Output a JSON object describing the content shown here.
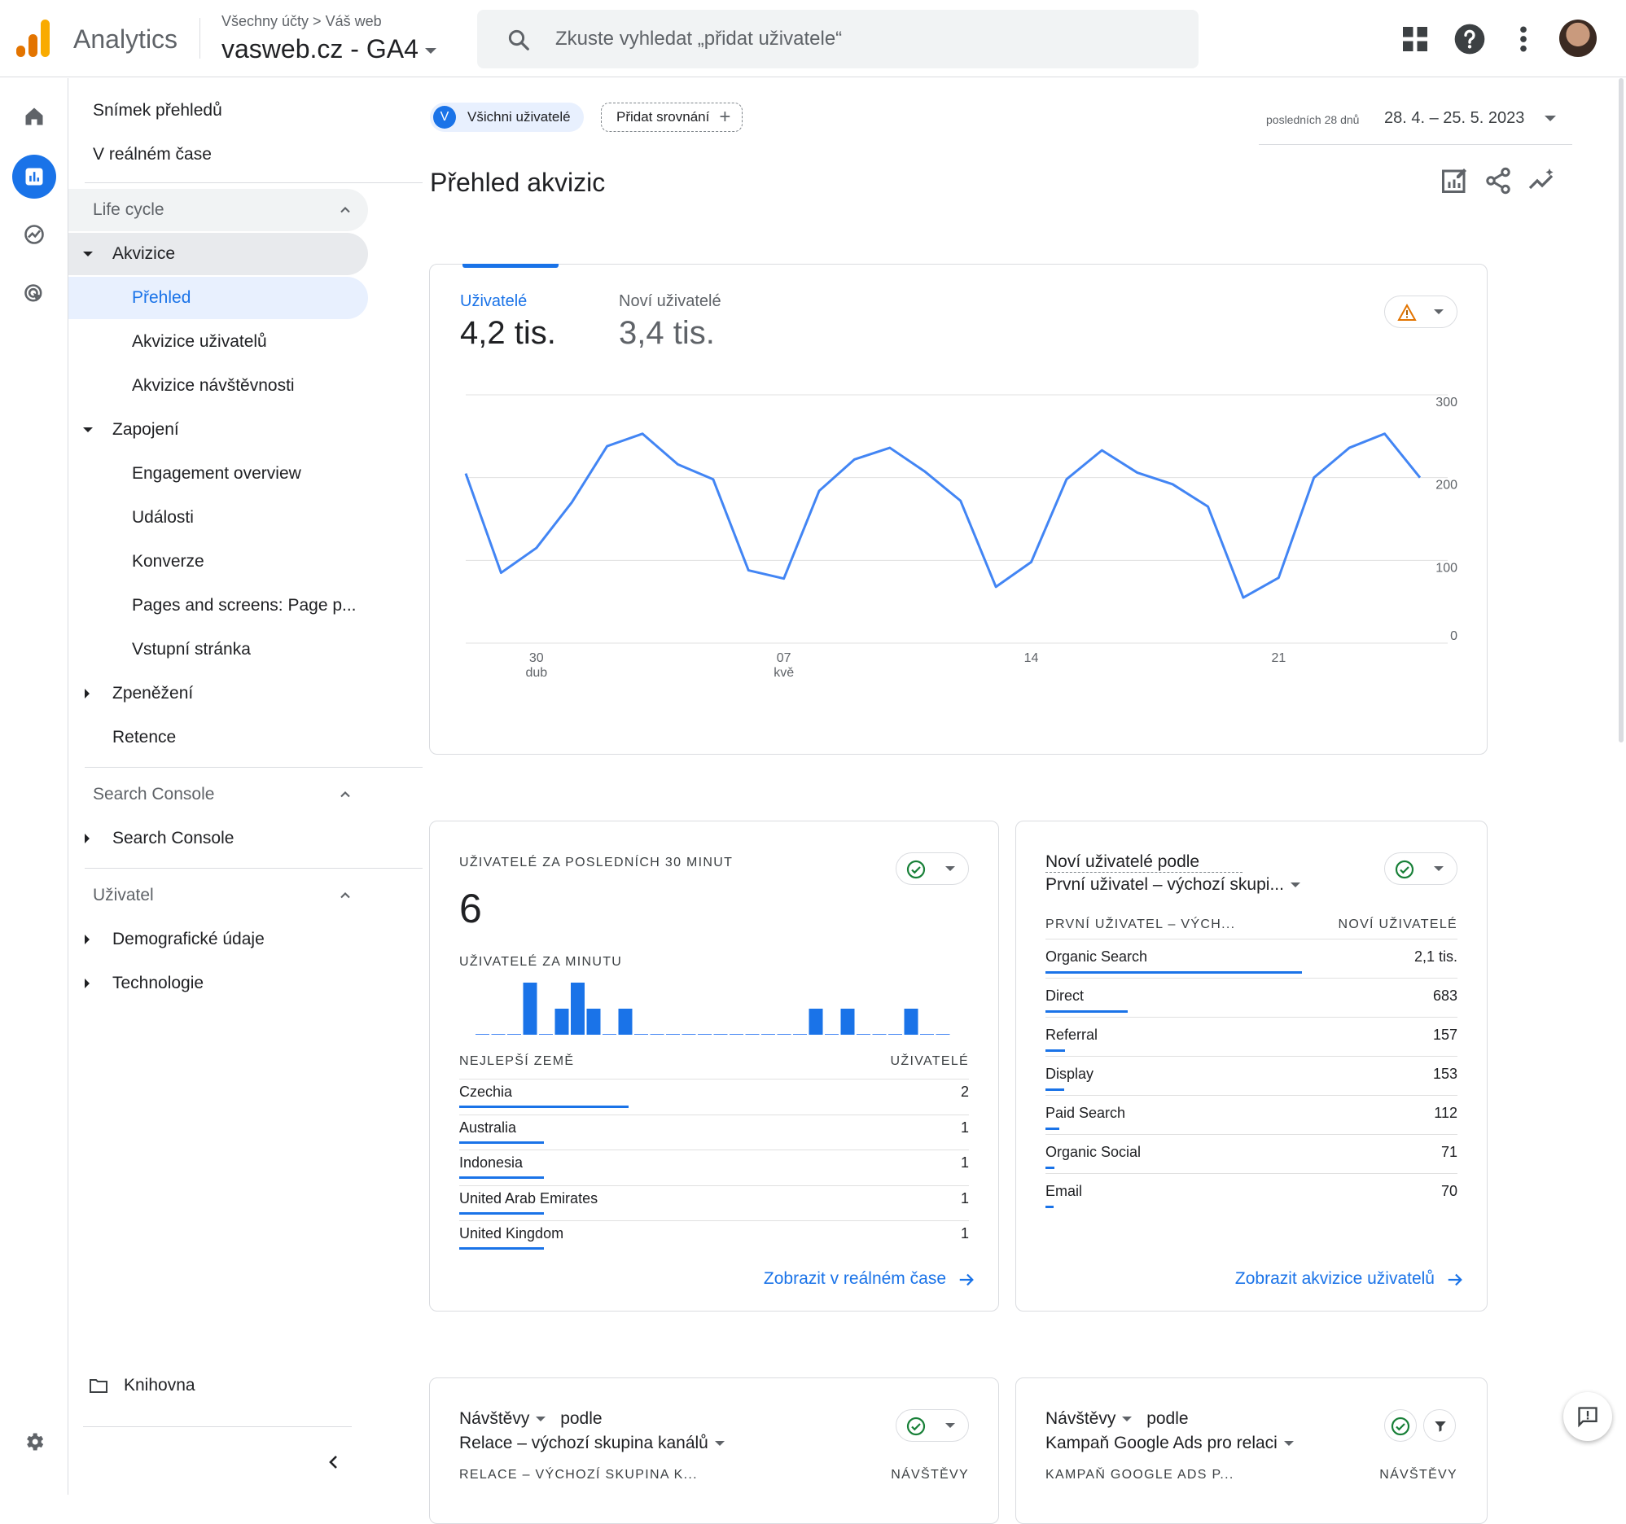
{
  "app": {
    "name": "Analytics",
    "breadcrumb": "Všechny účty > Váš web",
    "property": "vasweb.cz - GA4",
    "search_placeholder": "Zkuste vyhledat „přidat uživatele“",
    "logo_colors": [
      "#f9ab00",
      "#e37400",
      "#e37400"
    ]
  },
  "nav": {
    "top_items": [
      "Snímek přehledů",
      "V reálném čase"
    ],
    "life_cycle_label": "Life cycle",
    "acquisition": {
      "label": "Akvizice",
      "children": [
        "Přehled",
        "Akvizice uživatelů",
        "Akvizice návštěvnosti"
      ]
    },
    "engagement": {
      "label": "Zapojení",
      "children": [
        "Engagement overview",
        "Události",
        "Konverze",
        "Pages and screens: Page p...",
        "Vstupní stránka"
      ]
    },
    "monetization": "Zpeněžení",
    "retention": "Retence",
    "search_console_section": "Search Console",
    "search_console_item": "Search Console",
    "user_section": "Uživatel",
    "demographics": "Demografické údaje",
    "technology": "Technologie",
    "library": "Knihovna"
  },
  "header": {
    "filter_badge": "V",
    "filter_label": "Všichni uživatelé",
    "compare_label": "Přidat srovnání",
    "date_period": "posledních 28 dnů",
    "date_range": "28. 4. – 25. 5. 2023",
    "page_title": "Přehled akvizic"
  },
  "metrics": {
    "users_label": "Uživatelé",
    "users_value": "4,2 tis.",
    "new_users_label": "Noví uživatelé",
    "new_users_value": "3,4 tis."
  },
  "chart_data": {
    "type": "line",
    "series": [
      {
        "values": [
          205,
          85,
          115,
          170,
          238,
          253,
          216,
          198,
          88,
          78,
          184,
          222,
          236,
          207,
          172,
          68,
          98,
          198,
          233,
          206,
          192,
          165,
          55,
          79,
          200,
          236,
          253,
          200
        ]
      }
    ],
    "x_ticks": [
      {
        "day": "30",
        "month": "dub",
        "index": 2
      },
      {
        "day": "07",
        "month": "kvě",
        "index": 9
      },
      {
        "day": "14",
        "month": "",
        "index": 16
      },
      {
        "day": "21",
        "month": "",
        "index": 23
      }
    ],
    "y_ticks": [
      "300",
      "200",
      "100",
      "0"
    ],
    "ylim": [
      0,
      300
    ],
    "color": "#4285f4",
    "grid": true
  },
  "realtime": {
    "title": "UŽIVATELÉ ZA POSLEDNÍCH 30 MINUT",
    "value": "6",
    "per_minute_label": "UŽIVATELÉ ZA MINUTU",
    "per_minute": [
      0,
      0,
      0,
      2,
      0,
      1,
      2,
      1,
      0,
      1,
      0,
      0,
      0,
      0,
      0,
      0,
      0,
      0,
      0,
      0,
      0,
      1,
      0,
      1,
      0,
      0,
      0,
      1,
      0,
      0
    ],
    "table_header": "NEJLEPŠÍ ZEMĚ",
    "table_value_header": "UŽIVATELÉ",
    "rows": [
      {
        "label": "Czechia",
        "value": "2",
        "share": 1.0
      },
      {
        "label": "Australia",
        "value": "1",
        "share": 0.5
      },
      {
        "label": "Indonesia",
        "value": "1",
        "share": 0.5
      },
      {
        "label": "United Arab Emirates",
        "value": "1",
        "share": 0.5
      },
      {
        "label": "United Kingdom",
        "value": "1",
        "share": 0.5
      }
    ],
    "link": "Zobrazit v reálném čase"
  },
  "new_users_card": {
    "title_line1": "Noví uživatelé podle",
    "title_line2": "První uživatel – výchozí skupi...",
    "col_dim": "PRVNÍ UŽIVATEL – VÝCH...",
    "col_metric": "NOVÍ UŽIVATELÉ",
    "rows": [
      {
        "label": "Organic Search",
        "value": "2,1 tis.",
        "share": 1.0
      },
      {
        "label": "Direct",
        "value": "683",
        "share": 0.32
      },
      {
        "label": "Referral",
        "value": "157",
        "share": 0.075
      },
      {
        "label": "Display",
        "value": "153",
        "share": 0.073
      },
      {
        "label": "Paid Search",
        "value": "112",
        "share": 0.054
      },
      {
        "label": "Organic Social",
        "value": "71",
        "share": 0.034
      },
      {
        "label": "Email",
        "value": "70",
        "share": 0.033
      }
    ],
    "link": "Zobrazit akvizice uživatelů"
  },
  "sessions_card": {
    "metric": "Návštěvy",
    "by": "podle",
    "dimension": "Relace – výchozí skupina kanálů",
    "col_dim": "RELACE – VÝCHOZÍ SKUPINA K...",
    "col_metric": "NÁVŠTĚVY"
  },
  "campaign_card": {
    "metric": "Návštěvy",
    "by": "podle",
    "dimension": "Kampaň Google Ads pro relaci",
    "col_dim": "KAMPAŇ GOOGLE ADS P...",
    "col_metric": "NÁVŠTĚVY"
  }
}
